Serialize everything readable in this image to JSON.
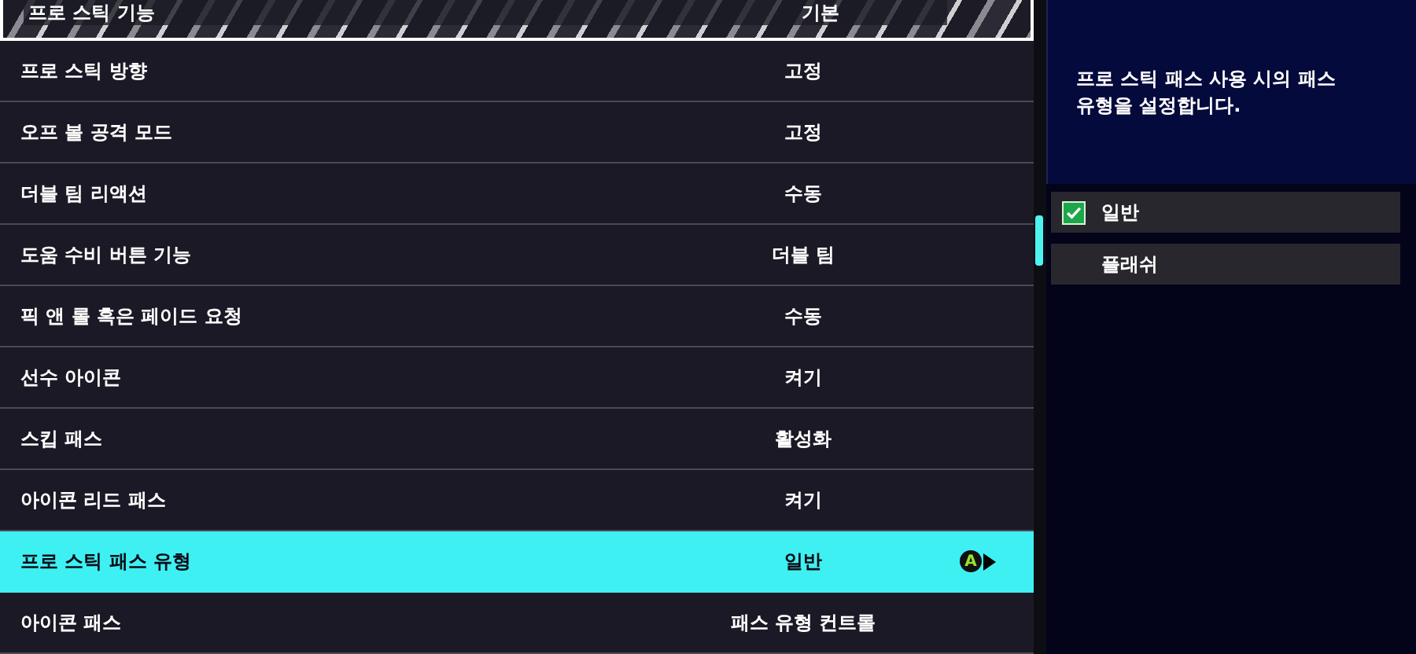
{
  "settings": [
    {
      "label": "프로 스틱 기능",
      "value": "기본",
      "selected": false,
      "focused": true
    },
    {
      "label": "프로 스틱 방향",
      "value": "고정",
      "selected": false,
      "focused": false
    },
    {
      "label": "오프 볼 공격 모드",
      "value": "고정",
      "selected": false,
      "focused": false
    },
    {
      "label": "더블 팀 리액션",
      "value": "수동",
      "selected": false,
      "focused": false
    },
    {
      "label": "도움 수비 버튼 기능",
      "value": "더블 팀",
      "selected": false,
      "focused": false
    },
    {
      "label": "픽 앤 롤 혹은 페이드 요청",
      "value": "수동",
      "selected": false,
      "focused": false
    },
    {
      "label": "선수 아이콘",
      "value": "켜기",
      "selected": false,
      "focused": false
    },
    {
      "label": "스킵 패스",
      "value": "활성화",
      "selected": false,
      "focused": false
    },
    {
      "label": "아이콘 리드 패스",
      "value": "켜기",
      "selected": false,
      "focused": false
    },
    {
      "label": "프로 스틱 패스 유형",
      "value": "일반",
      "selected": true,
      "focused": false,
      "button_hint": "A"
    },
    {
      "label": "아이콘 패스",
      "value": "패스 유형 컨트롤",
      "selected": false,
      "focused": false
    }
  ],
  "description": "프로 스틱 패스 사용 시의 패스 유형을 설정합니다.",
  "options": [
    {
      "label": "일반",
      "checked": true
    },
    {
      "label": "플래쉬",
      "checked": false
    }
  ]
}
